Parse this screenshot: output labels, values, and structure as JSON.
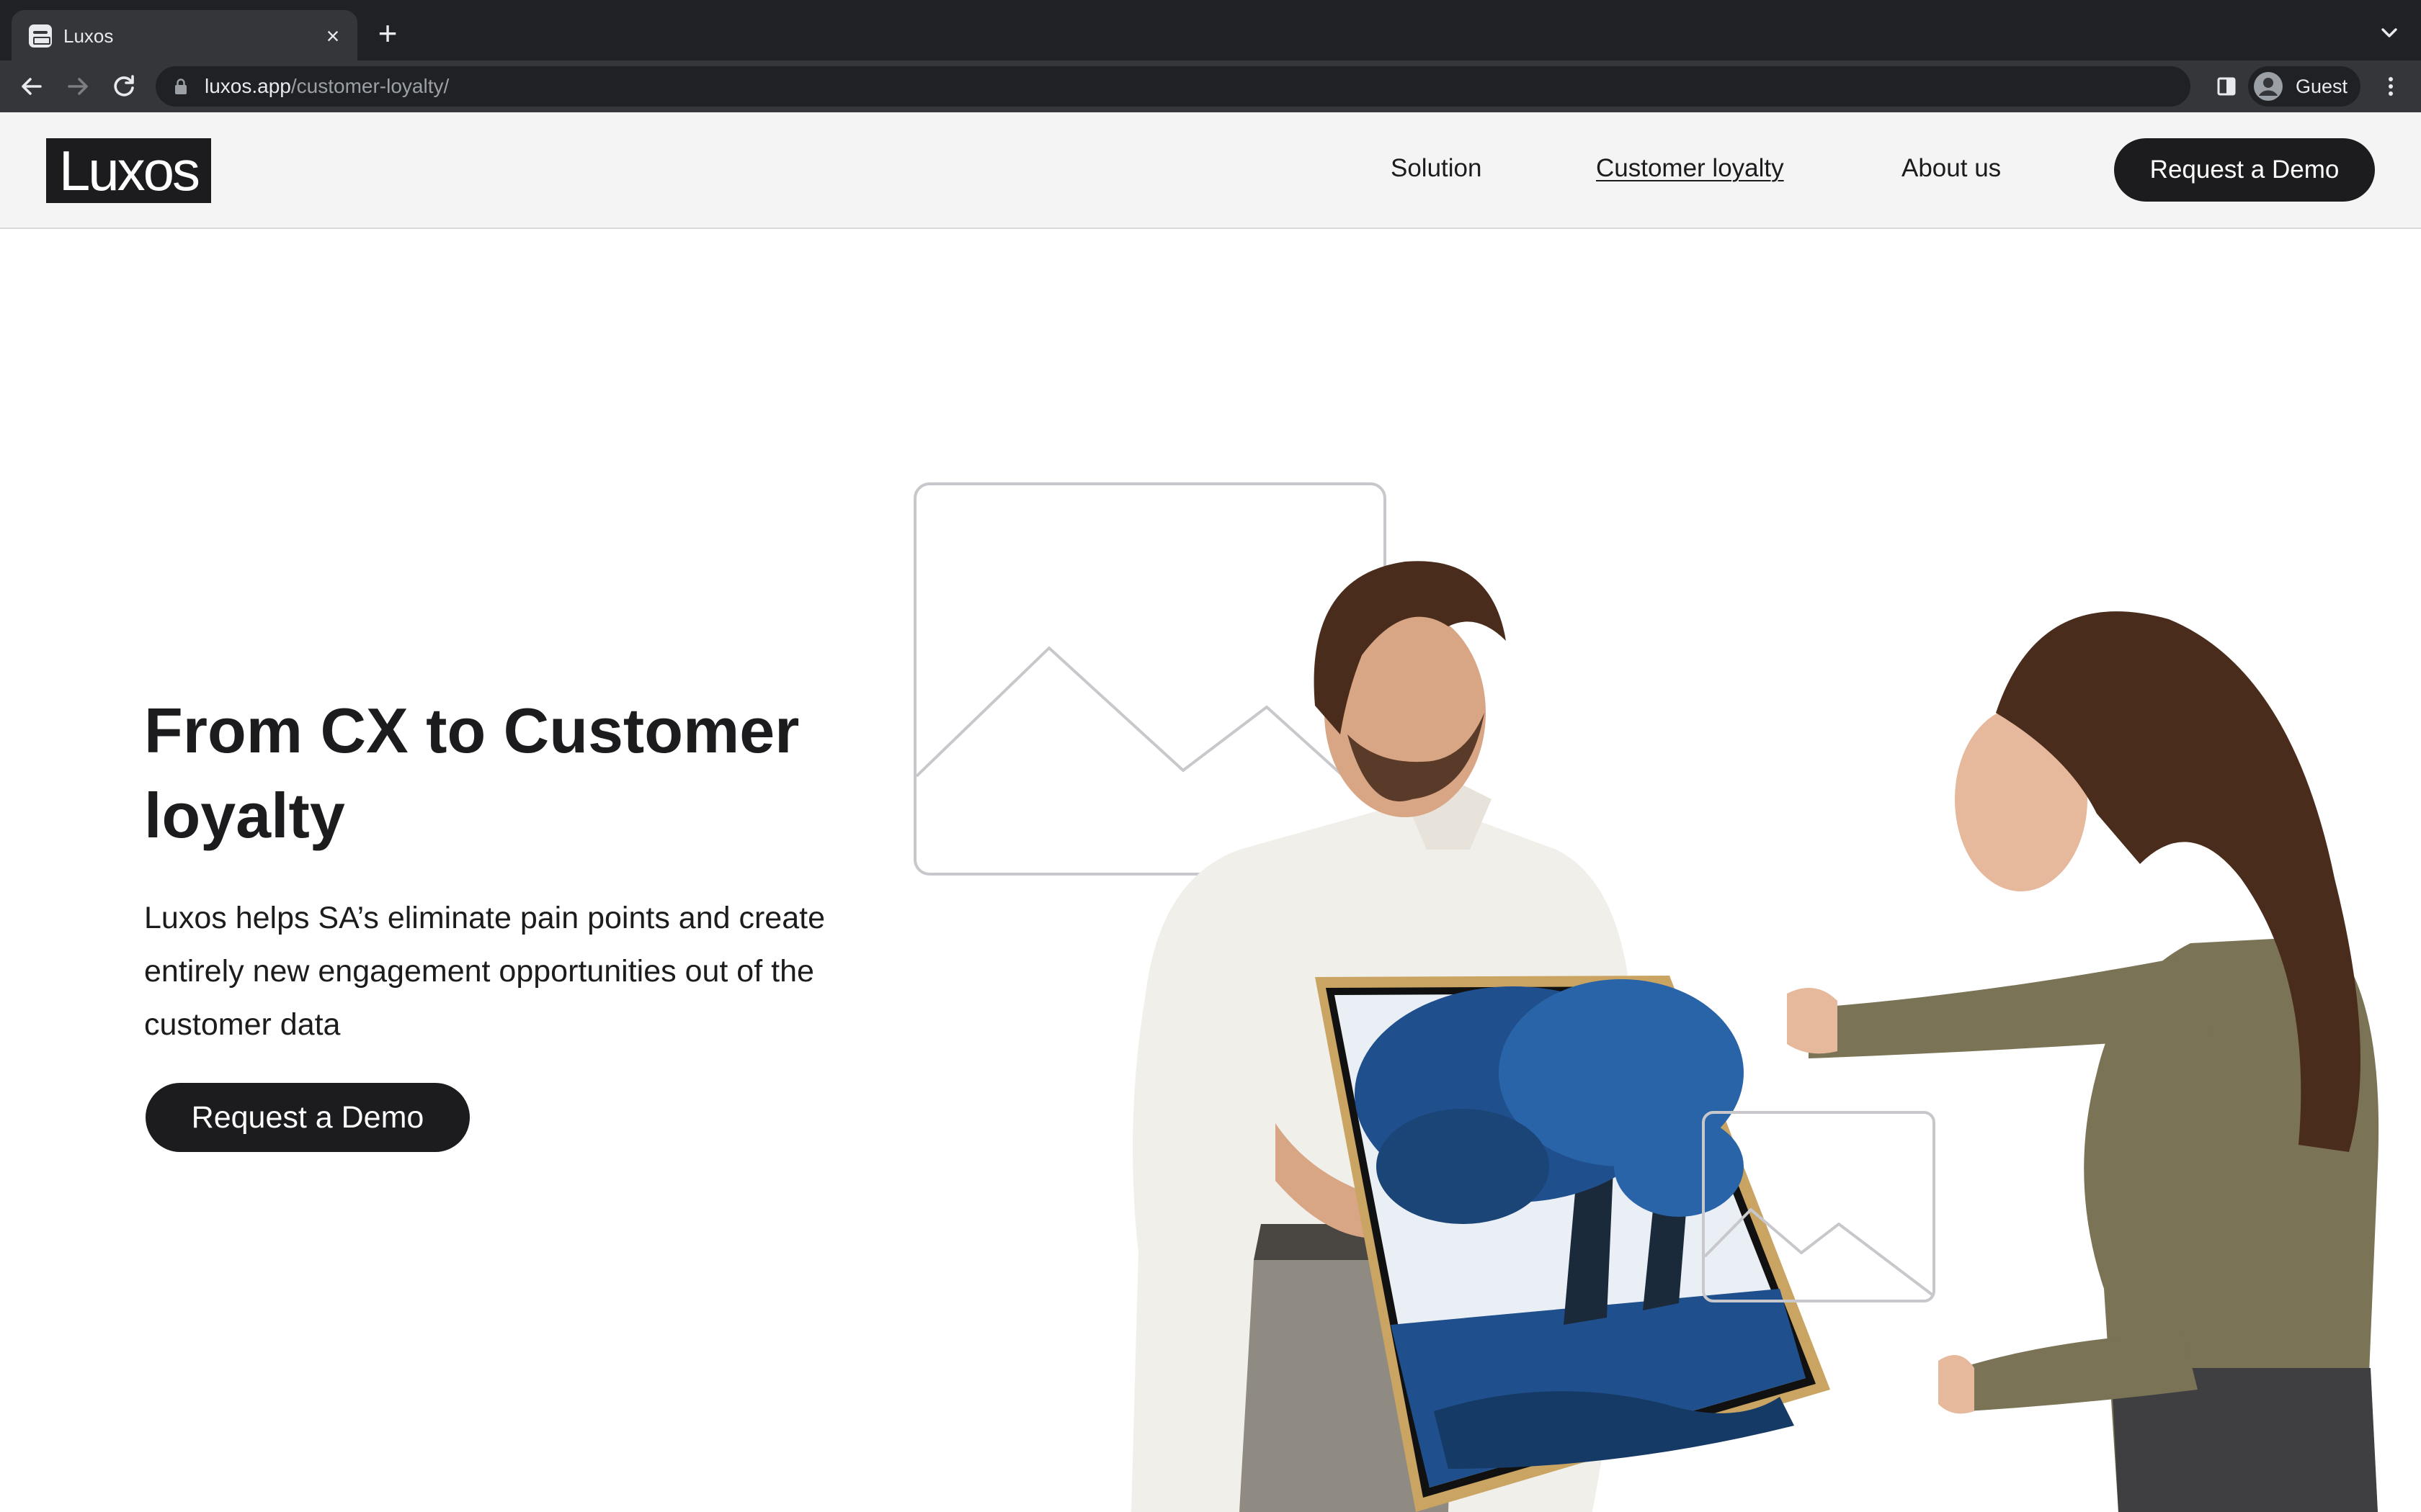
{
  "browser": {
    "tab_title": "Luxos",
    "tab_close_glyph": "×",
    "new_tab_glyph": "+",
    "url_host": "luxos.app",
    "url_path": "/customer-loyalty/",
    "profile_label": "Guest",
    "icons": [
      "page-favicon-icon",
      "close-icon",
      "plus-icon",
      "chevron-down-icon",
      "back-arrow-icon",
      "forward-arrow-icon",
      "reload-icon",
      "lock-icon",
      "side-panel-icon",
      "account-icon",
      "more-vertical-icon"
    ]
  },
  "site": {
    "logo_text": "Luxos",
    "nav": [
      {
        "label": "Solution",
        "active": false
      },
      {
        "label": "Customer loyalty",
        "active": true
      },
      {
        "label": "About us",
        "active": false
      }
    ],
    "header_cta": "Request a Demo"
  },
  "hero": {
    "title": "From CX to Customer loyalty",
    "description": "Luxos helps SA’s eliminate pain points and create entirely new engagement opportunities out of the customer data",
    "cta": "Request a Demo",
    "illustration": "image-placeholder-icon"
  },
  "colors": {
    "chrome_dark": "#202124",
    "chrome_toolbar": "#35363a",
    "header_bg": "#f4f4f5",
    "brand_dark": "#1c1c1e",
    "placeholder_stroke": "#c8c8cc",
    "shirt": "#f1efea",
    "sweater": "#7a7356",
    "hair": "#4a2c1c",
    "frame_gold": "#c9a463",
    "painting_blue": "#1f4f8c"
  }
}
